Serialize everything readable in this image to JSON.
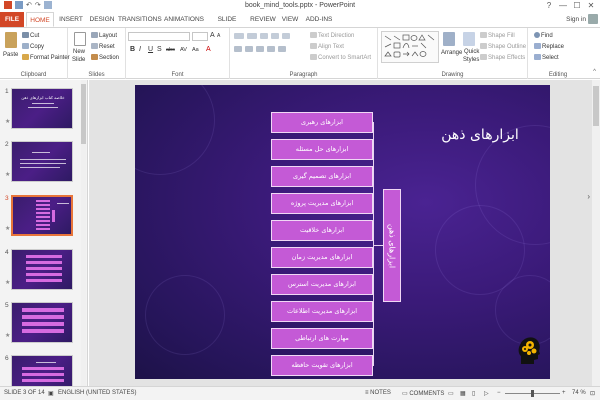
{
  "window": {
    "title": "book_mind_tools.pptx - PowerPoint",
    "controls": [
      "?",
      "—",
      "☐",
      "✕"
    ]
  },
  "tabs": [
    "FILE",
    "HOME",
    "INSERT",
    "DESIGN",
    "TRANSITIONS",
    "ANIMATIONS",
    "SLIDE SHOW",
    "REVIEW",
    "VIEW",
    "ADD-INS"
  ],
  "active_tab": "HOME",
  "signin": "Sign in",
  "ribbon": {
    "clipboard": {
      "paste": "Paste",
      "cut": "Cut",
      "copy": "Copy",
      "format_painter": "Format Painter",
      "label": "Clipboard"
    },
    "slides": {
      "new_slide": "New",
      "new_slide2": "Slide",
      "layout": "Layout",
      "reset": "Reset",
      "section": "Section",
      "label": "Slides"
    },
    "font": {
      "label": "Font",
      "bold": "B",
      "italic": "I",
      "underline": "U",
      "shadow": "S",
      "strike": "abc",
      "grow": "A",
      "shrink": "A",
      "clear": "A",
      "spacing": "AV",
      "case": "Aa",
      "color": "A"
    },
    "paragraph": {
      "text_direction": "Text Direction",
      "align_text": "Align Text",
      "smartart": "Convert to SmartArt",
      "label": "Paragraph"
    },
    "drawing": {
      "arrange": "Arrange",
      "quick_styles": "Quick",
      "quick_styles2": "Styles",
      "shape_fill": "Shape Fill",
      "shape_outline": "Shape Outline",
      "shape_effects": "Shape Effects",
      "label": "Drawing"
    },
    "editing": {
      "find": "Find",
      "replace": "Replace",
      "select": "Select",
      "label": "Editing"
    }
  },
  "thumbnails": [
    {
      "num": "1",
      "text": "خلاصه کتاب ابزارهای ذهن"
    },
    {
      "num": "2",
      "text": ""
    },
    {
      "num": "3",
      "text": ""
    },
    {
      "num": "4",
      "text": ""
    },
    {
      "num": "5",
      "text": ""
    },
    {
      "num": "6",
      "text": ""
    }
  ],
  "slide": {
    "title": "ابزارهای ذهن",
    "vertical_label": "ابزارهای ذهن",
    "items": [
      "ابزارهای رهبری",
      "ابزارهای حل مسئله",
      "ابزارهای تصمیم گیری",
      "ابزارهای مدیریت پروژه",
      "ابزارهای خلاقیت",
      "ابزارهای مدیریت زمان",
      "ابزارهای مدیریت استرس",
      "ابزارهای مدیریت اطلاعات",
      "مهارت های ارتباطی",
      "ابزارهای تقویت حافظه"
    ]
  },
  "status": {
    "slide_of": "SLIDE 3 OF 14",
    "language": "ENGLISH (UNITED STATES)",
    "notes": "NOTES",
    "comments": "COMMENTS",
    "zoom": "74 %"
  },
  "colors": {
    "accent": "#d24726",
    "box": "#c45ad6",
    "slide_bg": "#3a1a78"
  }
}
